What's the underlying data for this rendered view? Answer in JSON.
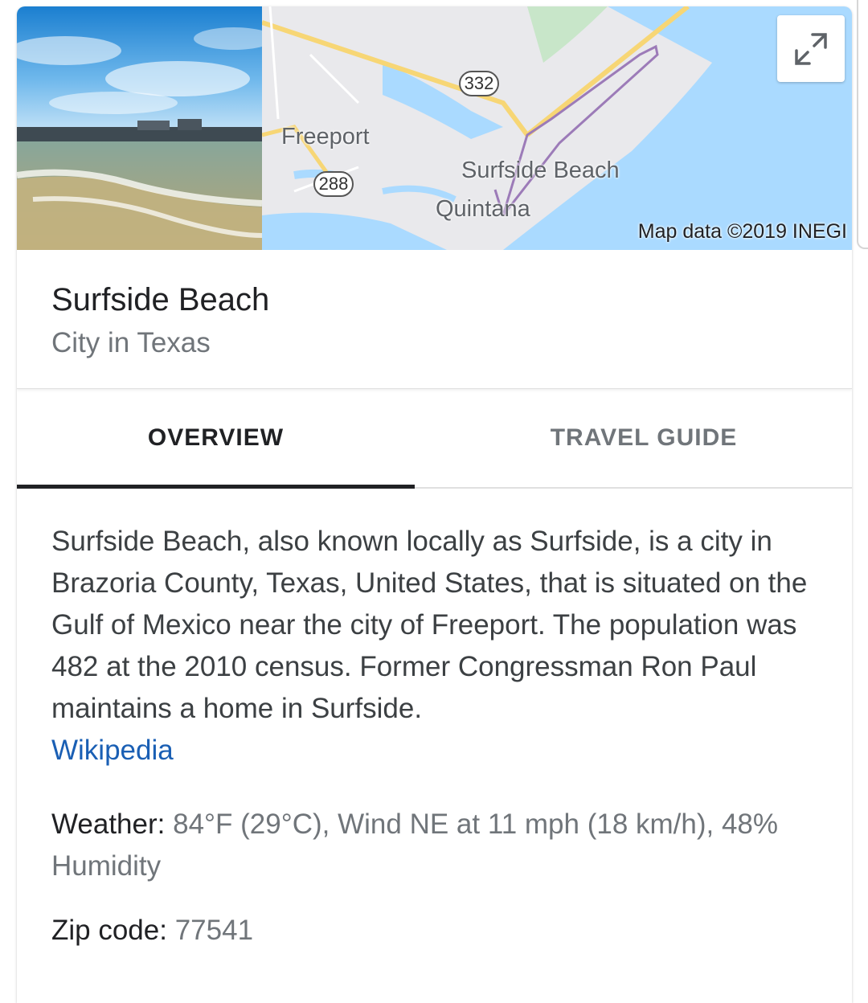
{
  "map": {
    "labels": {
      "freeport": "Freeport",
      "surfside": "Surfside Beach",
      "quintana": "Quintana"
    },
    "shields": {
      "hwy332": "332",
      "hwy288": "288"
    },
    "attribution": "Map data ©2019 INEGI",
    "expand_icon": "expand-icon"
  },
  "header": {
    "title": "Surfside Beach",
    "subtitle": "City in Texas"
  },
  "tabs": [
    {
      "label": "OVERVIEW",
      "active": true
    },
    {
      "label": "TRAVEL GUIDE",
      "active": false
    }
  ],
  "overview": {
    "description": "Surfside Beach, also known locally as Surfside, is a city in Brazoria County, Texas, United States, that is situated on the Gulf of Mexico near the city of Freeport. The population was 482 at the 2010 census. Former Congressman Ron Paul maintains a home in Surfside.",
    "source_link": "Wikipedia",
    "weather": {
      "label": "Weather:",
      "value": "84°F (29°C), Wind NE at 11 mph (18 km/h), 48% Humidity"
    },
    "zip": {
      "label": "Zip code:",
      "value": "77541"
    }
  },
  "colors": {
    "link": "#1a5fb4",
    "text_primary": "#202124",
    "text_secondary": "#70757a",
    "water": "#aadaff",
    "highway": "#f7d675",
    "boundary": "#9c7bb8"
  }
}
